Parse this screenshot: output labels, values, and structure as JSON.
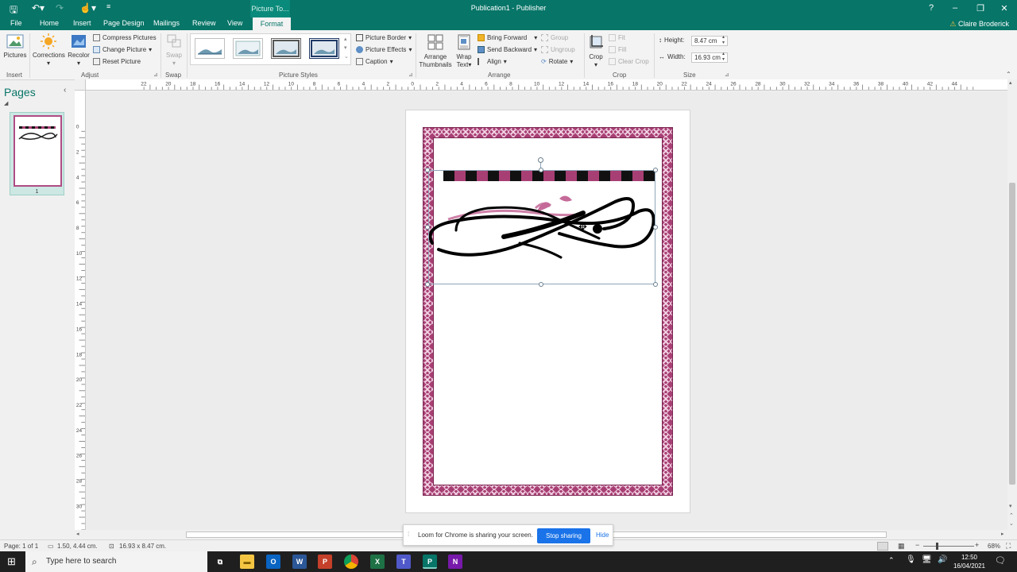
{
  "titlebar": {
    "contextual_tab": "Picture To...",
    "document_title": "Publication1 - Publisher",
    "help": "?",
    "minimize": "–",
    "restore": "❐",
    "close": "✕"
  },
  "tabs": {
    "file": "File",
    "home": "Home",
    "insert": "Insert",
    "page_design": "Page Design",
    "mailings": "Mailings",
    "review": "Review",
    "view": "View",
    "format": "Format",
    "user": "Claire Broderick"
  },
  "ribbon": {
    "insert_group": {
      "pictures": "Pictures",
      "label": "Insert"
    },
    "adjust_group": {
      "corrections": "Corrections",
      "recolor": "Recolor",
      "compress": "Compress Pictures",
      "change": "Change Picture",
      "reset": "Reset Picture",
      "label": "Adjust"
    },
    "swap_group": {
      "swap": "Swap",
      "label": "Swap"
    },
    "styles_group": {
      "border": "Picture Border",
      "effects": "Picture Effects",
      "caption": "Caption",
      "label": "Picture Styles"
    },
    "arrange_group": {
      "arrange_thumbnails_1": "Arrange",
      "arrange_thumbnails_2": "Thumbnails",
      "wrap_text_1": "Wrap",
      "wrap_text_2": "Text",
      "bring_forward": "Bring Forward",
      "send_backward": "Send Backward",
      "align": "Align",
      "group": "Group",
      "ungroup": "Ungroup",
      "rotate": "Rotate",
      "label": "Arrange"
    },
    "crop_group": {
      "crop": "Crop",
      "fit": "Fit",
      "fill": "Fill",
      "clear_crop": "Clear Crop",
      "label": "Crop"
    },
    "size_group": {
      "height_label": "Height:",
      "height_value": "8.47 cm",
      "width_label": "Width:",
      "width_value": "16.93 cm",
      "label": "Size"
    }
  },
  "pages_pane": {
    "title": "Pages",
    "page_number": "1"
  },
  "hruler_labels": [
    "22",
    "20",
    "18",
    "16",
    "14",
    "12",
    "10",
    "8",
    "6",
    "4",
    "2",
    "0",
    "2",
    "4",
    "6",
    "8",
    "10",
    "12",
    "14",
    "16",
    "18",
    "20",
    "22",
    "24",
    "26",
    "28",
    "30",
    "32",
    "34",
    "36",
    "38",
    "40",
    "42",
    "44"
  ],
  "vruler_labels": [
    "0",
    "2",
    "4",
    "6",
    "8",
    "10",
    "12",
    "14",
    "16",
    "18",
    "20",
    "22",
    "24",
    "26",
    "28",
    "30"
  ],
  "statusbar": {
    "page": "Page: 1 of 1",
    "position": "1.50, 4.44 cm.",
    "size": "16.93 x  8.47 cm.",
    "zoom": "68%"
  },
  "sharebar": {
    "message": "Loom for Chrome is sharing your screen.",
    "stop": "Stop sharing",
    "hide": "Hide"
  },
  "taskbar": {
    "search_placeholder": "Type here to search",
    "time": "12:50",
    "date": "16/04/2021"
  },
  "colors": {
    "publisher_green": "#077568",
    "border_magenta": "#a83f74",
    "stop_blue": "#1a73e8"
  }
}
